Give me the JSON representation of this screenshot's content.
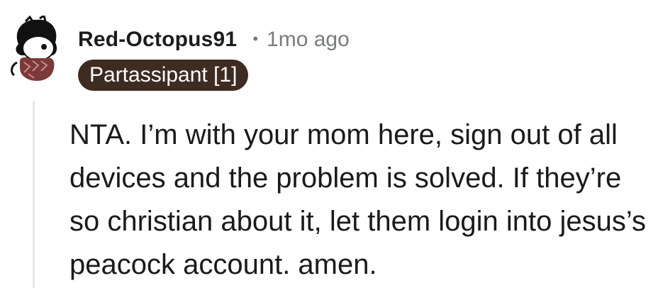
{
  "comment": {
    "username": "Red-Octopus91",
    "separator": "•",
    "timestamp": "1mo ago",
    "flair": "Partassipant [1]",
    "body": "NTA. I’m with your mom here, sign out of all devices and the problem is solved. If they’re so christian about it, let them login into jesus’s peacock account. amen."
  },
  "avatar": {
    "icon": "snoo-avatar-icon",
    "colors": {
      "hair": "#111111",
      "skin": "#ffffff",
      "shirt": "#7a3a3a",
      "shirt_pattern": "#c98a8a"
    }
  },
  "colors": {
    "flair_bg": "#3e2b22",
    "flair_text": "#ffffff",
    "meta_gray": "#787c7e",
    "thread_line": "#e4e6e8"
  }
}
